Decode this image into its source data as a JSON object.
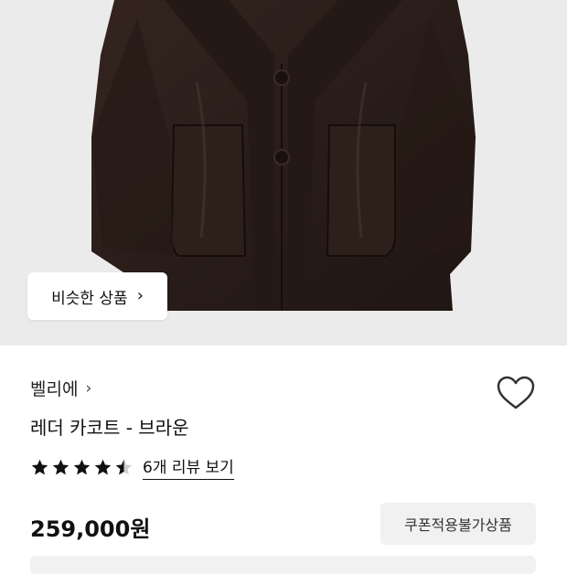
{
  "image": {
    "alt": "product photo - dark brown leather car coat"
  },
  "similar_button": {
    "label": "비슷한 상품",
    "chevron": "›"
  },
  "brand": {
    "name": "벨리에",
    "chevron": "›"
  },
  "product": {
    "name": "레더 카코트 - 브라운",
    "price": "259,000원"
  },
  "rating": {
    "stars": 4.5,
    "review_link": "6개 리뷰 보기"
  },
  "coupon": {
    "label": "쿠폰적용불가상품"
  },
  "icons": {
    "wishlist": "heart-outline-icon",
    "star": "star-icon"
  },
  "colors": {
    "coat": "#2b1f1b",
    "background": "#ecebec",
    "badge_bg": "#f1f1f2"
  }
}
